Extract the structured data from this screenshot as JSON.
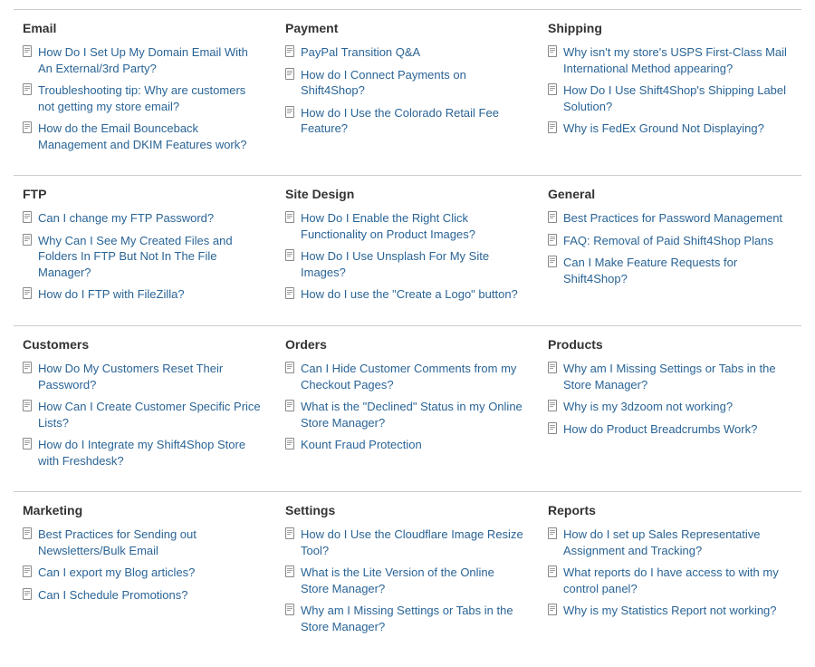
{
  "sections": [
    {
      "id": "email",
      "title": "Email",
      "links": [
        "How Do I Set Up My Domain Email With An External/3rd Party?",
        "Troubleshooting tip: Why are customers not getting my store email?",
        "How do the Email Bounceback Management and DKIM Features work?"
      ]
    },
    {
      "id": "payment",
      "title": "Payment",
      "links": [
        "PayPal Transition Q&A",
        "How do I Connect Payments on Shift4Shop?",
        "How do I Use the Colorado Retail Fee Feature?"
      ]
    },
    {
      "id": "shipping",
      "title": "Shipping",
      "links": [
        "Why isn't my store's USPS First-Class Mail International Method appearing?",
        "How Do I Use Shift4Shop's Shipping Label Solution?",
        "Why is FedEx Ground Not Displaying?"
      ]
    },
    {
      "id": "ftp",
      "title": "FTP",
      "links": [
        "Can I change my FTP Password?",
        "Why Can I See My Created Files and Folders In FTP But Not In The File Manager?",
        "How do I FTP with FileZilla?"
      ]
    },
    {
      "id": "site-design",
      "title": "Site Design",
      "links": [
        "How Do I Enable the Right Click Functionality on Product Images?",
        "How Do I Use Unsplash For My Site Images?",
        "How do I use the \"Create a Logo\" button?"
      ]
    },
    {
      "id": "general",
      "title": "General",
      "links": [
        "Best Practices for Password Management",
        "FAQ: Removal of Paid Shift4Shop Plans",
        "Can I Make Feature Requests for Shift4Shop?"
      ]
    },
    {
      "id": "customers",
      "title": "Customers",
      "links": [
        "How Do My Customers Reset Their Password?",
        "How Can I Create Customer Specific Price Lists?",
        "How do I Integrate my Shift4Shop Store with Freshdesk?"
      ]
    },
    {
      "id": "orders",
      "title": "Orders",
      "links": [
        "Can I Hide Customer Comments from my Checkout Pages?",
        "What is the \"Declined\" Status in my Online Store Manager?",
        "Kount Fraud Protection"
      ]
    },
    {
      "id": "products",
      "title": "Products",
      "links": [
        "Why am I Missing Settings or Tabs in the Store Manager?",
        "Why is my 3dzoom not working?",
        "How do Product Breadcrumbs Work?"
      ]
    },
    {
      "id": "marketing",
      "title": "Marketing",
      "links": [
        "Best Practices for Sending out Newsletters/Bulk Email",
        "Can I export my Blog articles?",
        "Can I Schedule Promotions?"
      ]
    },
    {
      "id": "settings",
      "title": "Settings",
      "links": [
        "How do I Use the Cloudflare Image Resize Tool?",
        "What is the Lite Version of the Online Store Manager?",
        "Why am I Missing Settings or Tabs in the Store Manager?"
      ]
    },
    {
      "id": "reports",
      "title": "Reports",
      "links": [
        "How do I set up Sales Representative Assignment and Tracking?",
        "What reports do I have access to with my control panel?",
        "Why is my Statistics Report not working?"
      ]
    }
  ]
}
